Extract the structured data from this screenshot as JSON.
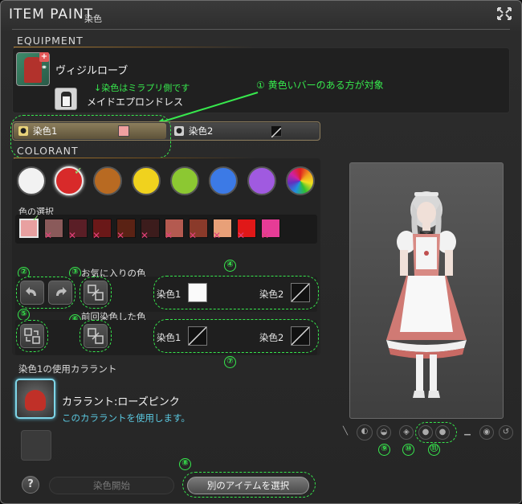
{
  "window": {
    "title": "ITEM PAINT",
    "subtitle": "染色",
    "close_icon": "close-arrows-icon"
  },
  "equipment": {
    "section_label": "EQUIPMENT",
    "main_item": {
      "name": "ヴィジルローブ",
      "plus_badge": "+",
      "link_badge": "⚭"
    },
    "sub_item": {
      "name": "メイドエプロンドレス"
    }
  },
  "annotations": {
    "note_mirage": "↓染色はミラプリ側です",
    "note_1": "① 黄色いバーのある方が対象",
    "n2": "②",
    "n3": "③",
    "n4": "④",
    "n5": "⑤",
    "n6": "⑥",
    "n7": "⑦",
    "n8": "⑧",
    "n9": "⑨",
    "n10": "⑩",
    "n11": "⑪"
  },
  "dye_tabs": [
    {
      "label": "染色1",
      "active": true,
      "swatch_color": "#f0a0a0"
    },
    {
      "label": "染色2",
      "active": false,
      "swatch_color": "none"
    }
  ],
  "colorant": {
    "section_label": "COLORANT",
    "categories": [
      {
        "name": "white",
        "color": "#f2f2f2"
      },
      {
        "name": "red",
        "color": "#d82a2a",
        "selected": true
      },
      {
        "name": "brown",
        "color": "#b86a22"
      },
      {
        "name": "yellow",
        "color": "#f0d21e"
      },
      {
        "name": "green",
        "color": "#8cc832"
      },
      {
        "name": "blue",
        "color": "#3c7ae6"
      },
      {
        "name": "purple",
        "color": "#a05ae0"
      },
      {
        "name": "rainbow",
        "color": "rainbow"
      }
    ],
    "shade_label": "色の選択",
    "shades": [
      {
        "color": "#e8a0a0",
        "selected": true,
        "unavailable": false
      },
      {
        "color": "#8a5a5a",
        "unavailable": true
      },
      {
        "color": "#5a1e26",
        "unavailable": true
      },
      {
        "color": "#6a1818",
        "unavailable": true
      },
      {
        "color": "#5a2214",
        "unavailable": true
      },
      {
        "color": "#3c1c1c",
        "unavailable": true
      },
      {
        "color": "#b45a50",
        "unavailable": true
      },
      {
        "color": "#8a3a2a",
        "unavailable": true
      },
      {
        "color": "#e8a078",
        "unavailable": true
      },
      {
        "color": "#e01818",
        "unavailable": true
      },
      {
        "color": "#e63c96",
        "unavailable": true
      }
    ]
  },
  "favorite": {
    "title": "お気に入りの色",
    "slot1_label": "染色1",
    "slot2_label": "染色2"
  },
  "previous": {
    "title": "前回染色した色",
    "slot1_label": "染色1",
    "slot2_label": "染色2"
  },
  "used_colorant": {
    "label": "染色1の使用カララント",
    "name": "カララント:ローズピンク",
    "desc": "このカララントを使用します。"
  },
  "buttons": {
    "help": "?",
    "start_dye": "染色開始",
    "select_other": "別のアイテムを選択"
  }
}
